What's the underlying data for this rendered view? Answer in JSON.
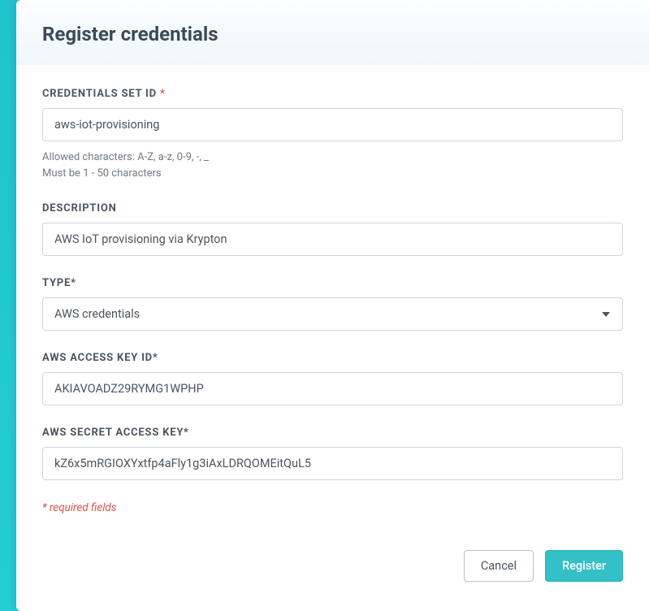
{
  "header": {
    "title": "Register credentials"
  },
  "form": {
    "credentials_set_id": {
      "label": "CREDENTIALS SET ID",
      "required_mark": " *",
      "value": "aws-iot-provisioning",
      "help_line1": "Allowed characters: A-Z, a-z, 0-9, -, _",
      "help_line2": "Must be 1 - 50 characters"
    },
    "description": {
      "label": "DESCRIPTION",
      "value": "AWS IoT provisioning via Krypton"
    },
    "type": {
      "label": "TYPE*",
      "value": "AWS credentials"
    },
    "aws_access_key_id": {
      "label": "AWS ACCESS KEY ID*",
      "value": "AKIAVOADZ29RYMG1WPHP"
    },
    "aws_secret_access_key": {
      "label": "AWS SECRET ACCESS KEY*",
      "value": "kZ6x5mRGIOXYxtfp4aFly1g3iAxLDRQOMEitQuL5"
    },
    "required_note": "* required fields"
  },
  "buttons": {
    "cancel": "Cancel",
    "register": "Register"
  }
}
